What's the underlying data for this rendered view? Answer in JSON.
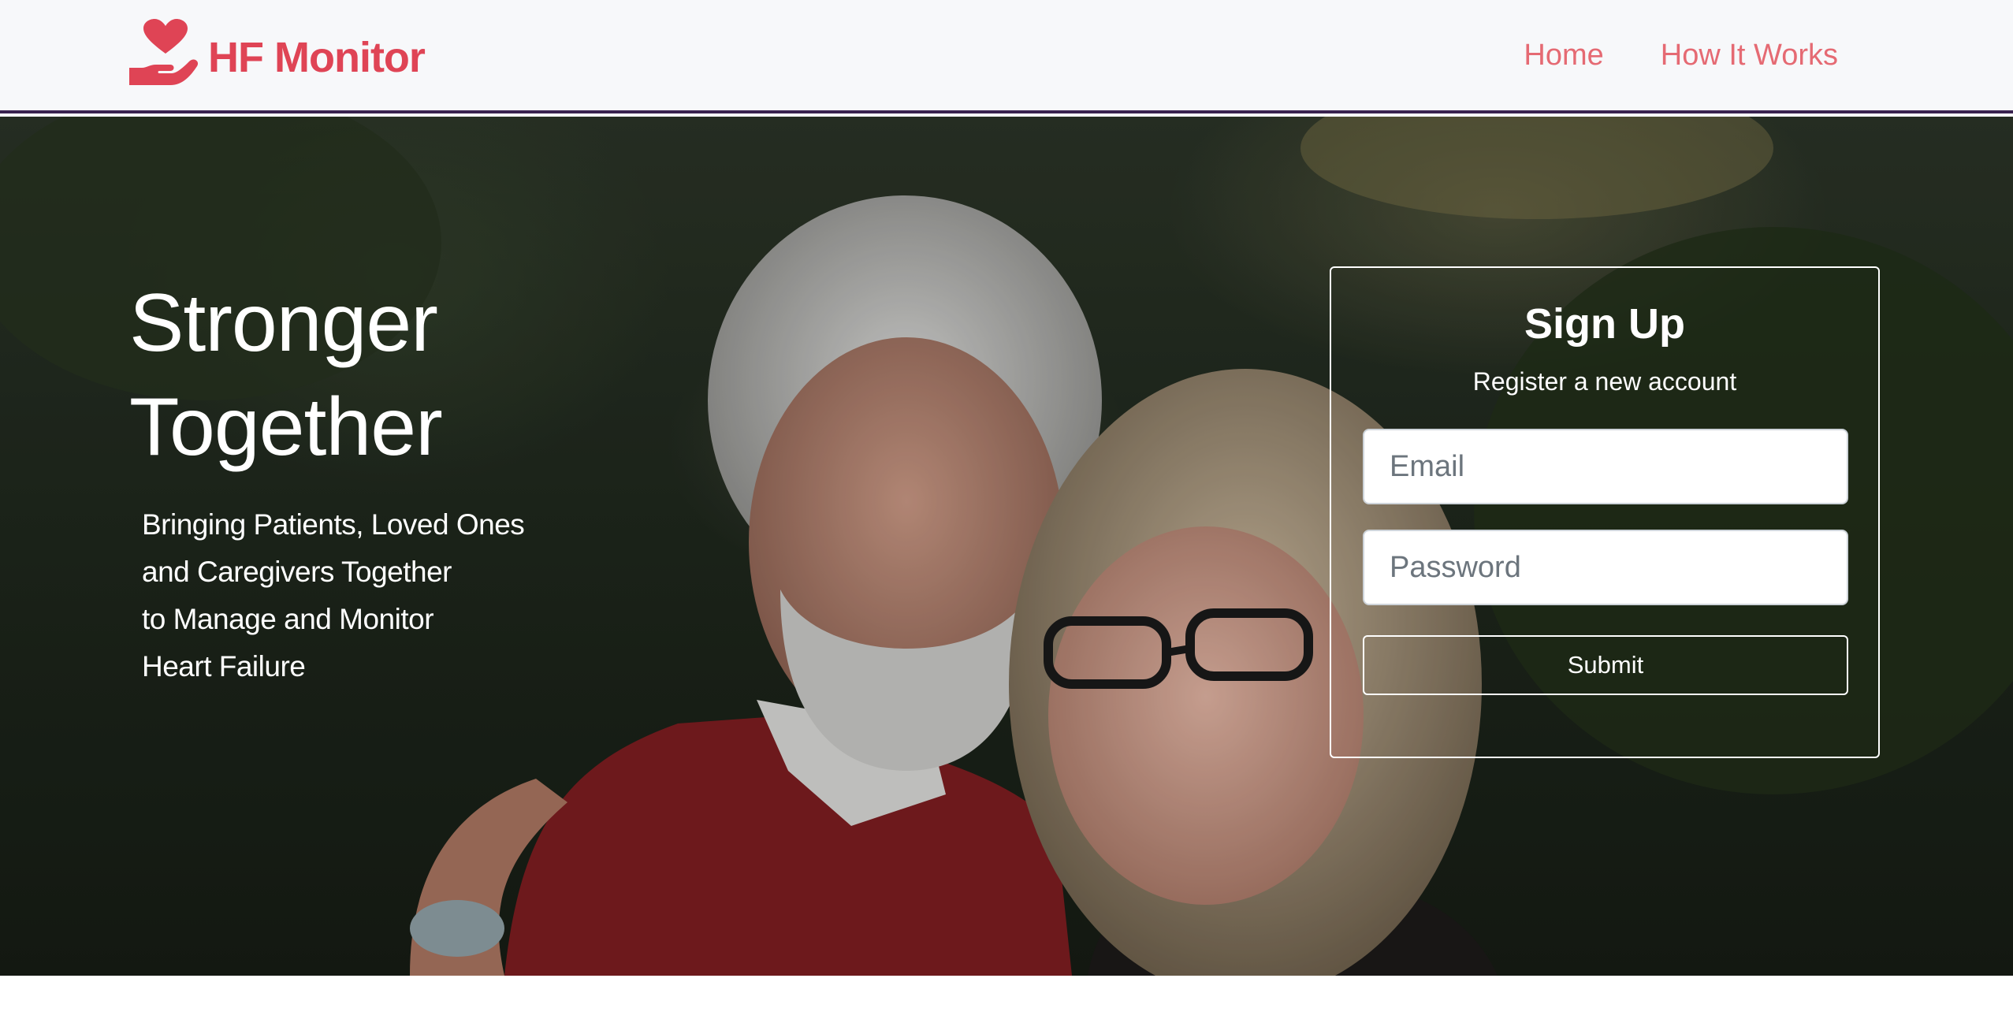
{
  "brand": {
    "name": "HF Monitor",
    "icon": "heart-in-hand-icon",
    "color": "#df4455"
  },
  "nav": {
    "links": [
      {
        "label": "Home"
      },
      {
        "label": "How It Works"
      }
    ],
    "link_color": "#e56a73"
  },
  "hero": {
    "title_line1": "Stronger",
    "title_line2": "Together",
    "tagline": [
      "Bringing Patients, Loved Ones",
      "and Caregivers Together",
      "to Manage and Monitor",
      "Heart Failure"
    ],
    "background": "photo of an older couple embracing outdoors"
  },
  "signup": {
    "title": "Sign Up",
    "subtitle": "Register a new account",
    "email_placeholder": "Email",
    "password_placeholder": "Password",
    "submit_label": "Submit"
  }
}
